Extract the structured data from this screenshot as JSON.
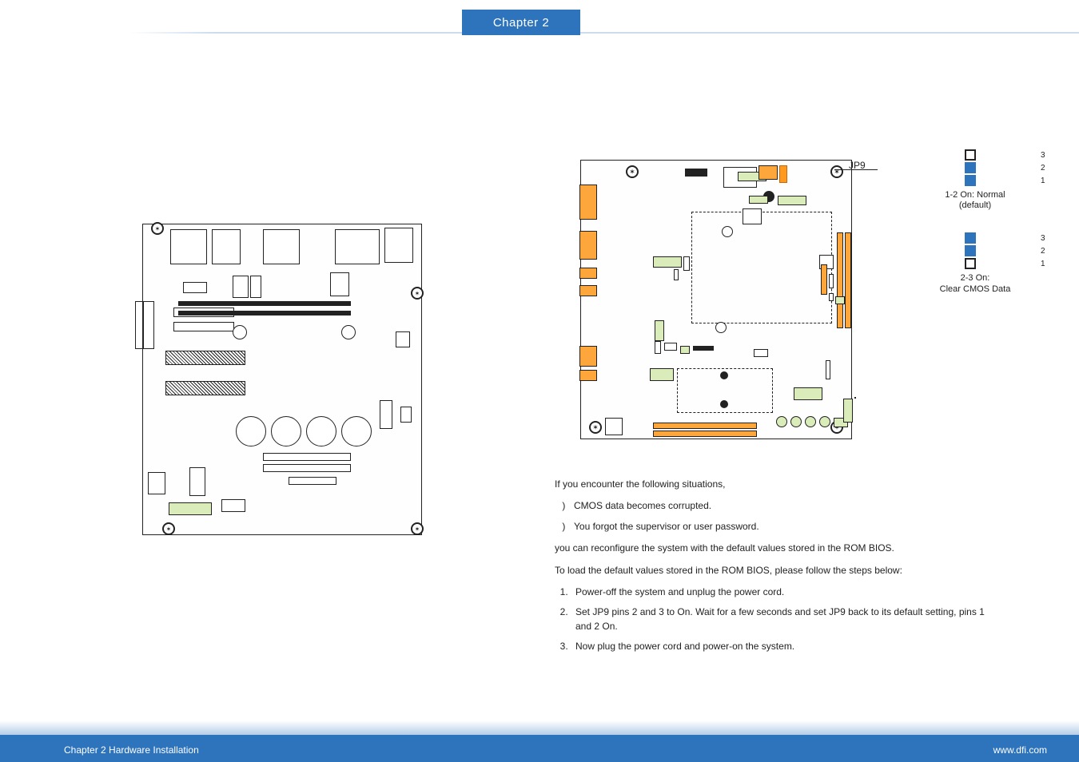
{
  "header": {
    "chapter_tab": "Chapter 2"
  },
  "footer": {
    "left": "Chapter 2 Hardware Installation",
    "right": "www.dfi.com"
  },
  "jp9": {
    "label": "JP9",
    "group1": {
      "pin_labels": [
        "3",
        "2",
        "1"
      ],
      "caption": "1-2 On: Normal\n(default)"
    },
    "group2": {
      "pin_labels": [
        "3",
        "2",
        "1"
      ],
      "caption": "2-3 On:\nClear CMOS Data"
    }
  },
  "body": {
    "intro": "If you encounter the following situations,",
    "situations": [
      "CMOS data becomes corrupted.",
      "You forgot the supervisor or user password."
    ],
    "reconfig": "you can reconfigure the system with the default values stored in the ROM BIOS.",
    "loadline": "To load the default values stored in the ROM BIOS, please follow the steps below:",
    "steps": [
      "Power-off the system and unplug the power cord.",
      "Set JP9 pins 2 and 3 to On. Wait for a few seconds and set JP9 back to its default setting, pins 1 and 2 On.",
      "Now plug the power cord and power-on the system."
    ]
  }
}
